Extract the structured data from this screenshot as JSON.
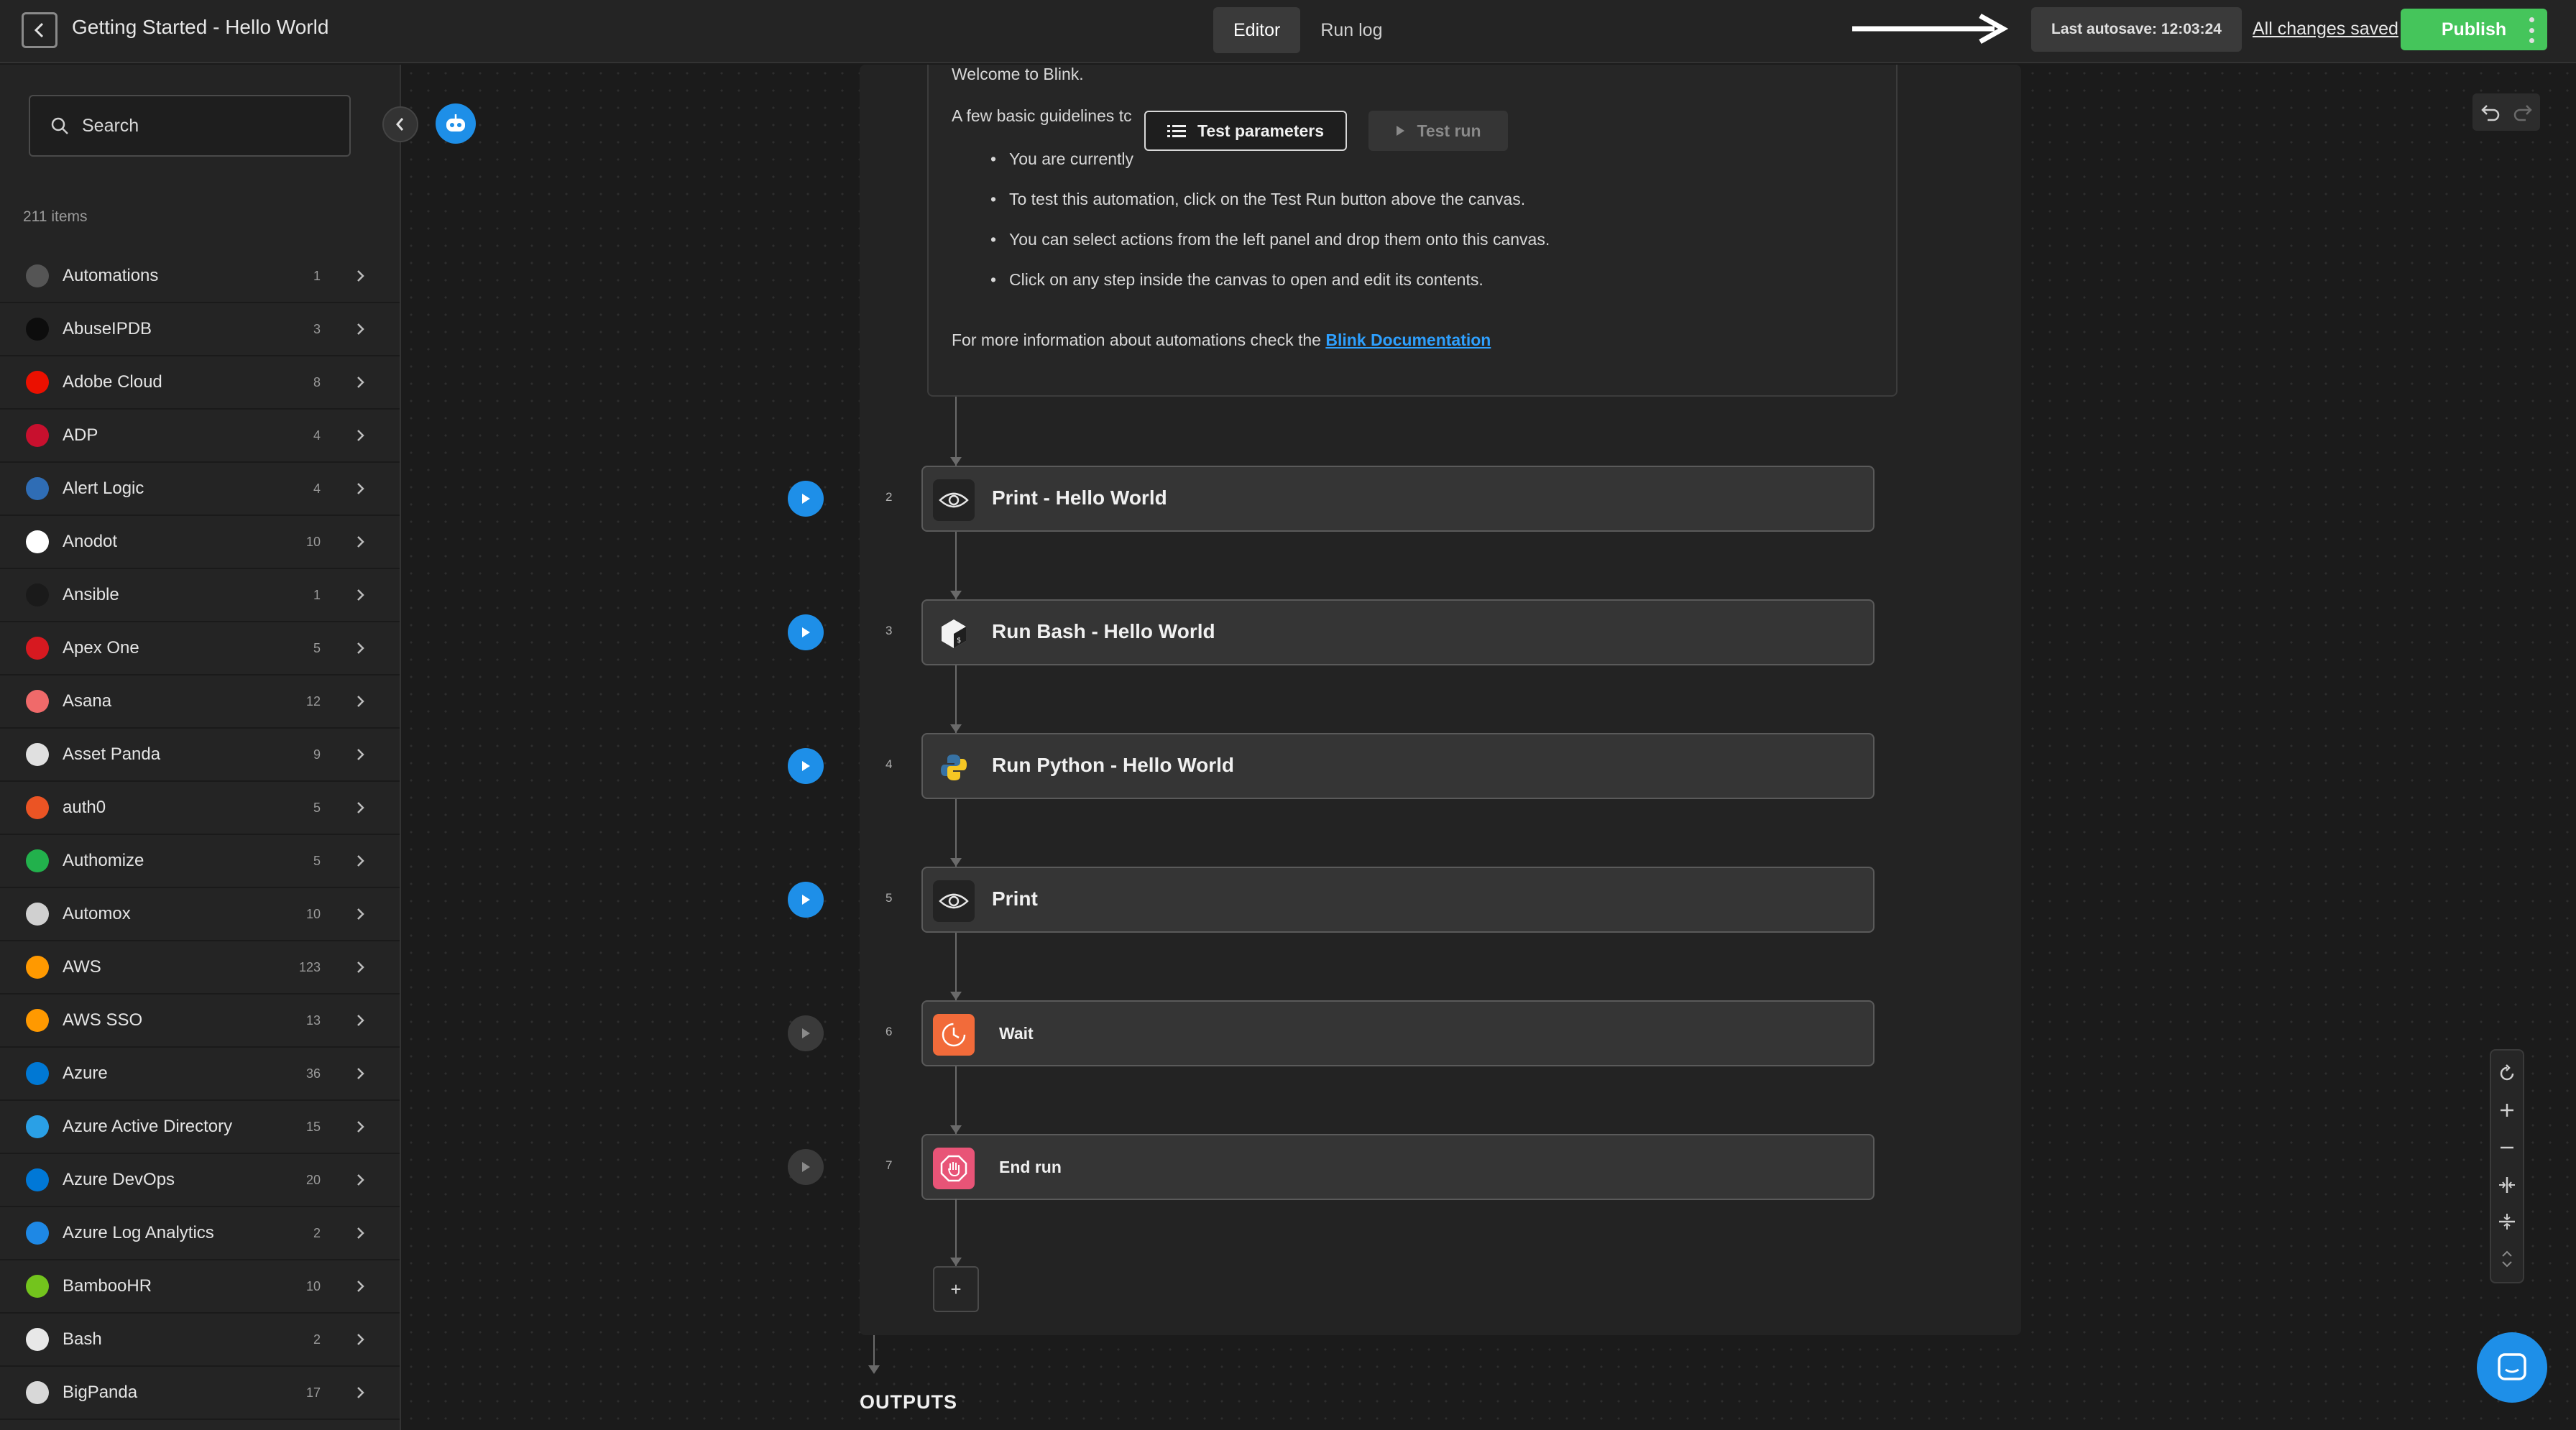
{
  "header": {
    "title": "Getting Started - Hello World",
    "tabs": [
      {
        "label": "Editor",
        "active": true
      },
      {
        "label": "Run log",
        "active": false
      }
    ],
    "autosave": "Last autosave: 12:03:24",
    "saved_status": "All changes saved",
    "publish_label": "Publish"
  },
  "sidebar": {
    "search_placeholder": "Search",
    "items_count": "211 items",
    "items": [
      {
        "label": "Automations",
        "count": "1",
        "icon": "automations-icon",
        "color": "#555555"
      },
      {
        "label": "AbuseIPDB",
        "count": "3",
        "icon": "abuseipdb-icon",
        "color": "#0d0d0d"
      },
      {
        "label": "Adobe Cloud",
        "count": "8",
        "icon": "adobe-icon",
        "color": "#eb1000"
      },
      {
        "label": "ADP",
        "count": "4",
        "icon": "adp-icon",
        "color": "#c8102e"
      },
      {
        "label": "Alert Logic",
        "count": "4",
        "icon": "alert-logic-icon",
        "color": "#2f6db5"
      },
      {
        "label": "Anodot",
        "count": "10",
        "icon": "anodot-icon",
        "color": "#ffffff"
      },
      {
        "label": "Ansible",
        "count": "1",
        "icon": "ansible-icon",
        "color": "#1a1a1a"
      },
      {
        "label": "Apex One",
        "count": "5",
        "icon": "apex-one-icon",
        "color": "#d71920"
      },
      {
        "label": "Asana",
        "count": "12",
        "icon": "asana-icon",
        "color": "#f06a6a"
      },
      {
        "label": "Asset Panda",
        "count": "9",
        "icon": "asset-panda-icon",
        "color": "#e0e0e0"
      },
      {
        "label": "auth0",
        "count": "5",
        "icon": "auth0-icon",
        "color": "#eb5424"
      },
      {
        "label": "Authomize",
        "count": "5",
        "icon": "authomize-icon",
        "color": "#22b14c"
      },
      {
        "label": "Automox",
        "count": "10",
        "icon": "automox-icon",
        "color": "#d0d0d0"
      },
      {
        "label": "AWS",
        "count": "123",
        "icon": "aws-icon",
        "color": "#ff9900"
      },
      {
        "label": "AWS SSO",
        "count": "13",
        "icon": "aws-sso-icon",
        "color": "#ff9900"
      },
      {
        "label": "Azure",
        "count": "36",
        "icon": "azure-icon",
        "color": "#0078d4"
      },
      {
        "label": "Azure Active Directory",
        "count": "15",
        "icon": "azure-ad-icon",
        "color": "#2aa0e6"
      },
      {
        "label": "Azure DevOps",
        "count": "20",
        "icon": "azure-devops-icon",
        "color": "#0078d7"
      },
      {
        "label": "Azure Log Analytics",
        "count": "2",
        "icon": "azure-log-analytics-icon",
        "color": "#1e88e5"
      },
      {
        "label": "BambooHR",
        "count": "10",
        "icon": "bamboohr-icon",
        "color": "#73c41d"
      },
      {
        "label": "Bash",
        "count": "2",
        "icon": "bash-icon",
        "color": "#e8e8e8"
      },
      {
        "label": "BigPanda",
        "count": "17",
        "icon": "bigpanda-icon",
        "color": "#d8d8d8"
      }
    ]
  },
  "welcome": {
    "line1": "Welcome to Blink.",
    "line2": "A few basic guidelines tc",
    "bullet1": "You are currently",
    "bullet2": "To test this automation, click on the Test Run button above the canvas.",
    "bullet3": "You can select actions from the left panel and drop them onto this canvas.",
    "bullet4": "Click on any step inside the canvas to open and edit its contents.",
    "more_info": "For more information about automations check the ",
    "doc_link": "Blink Documentation"
  },
  "toolbar": {
    "test_parameters": "Test parameters",
    "test_run": "Test run"
  },
  "steps": [
    {
      "num": "2",
      "title": "Print - Hello World",
      "icon": "eye-icon",
      "runnable": true
    },
    {
      "num": "3",
      "title": "Run Bash - Hello World",
      "icon": "bash-icon",
      "runnable": true
    },
    {
      "num": "4",
      "title": "Run Python - Hello World",
      "icon": "python-icon",
      "runnable": true
    },
    {
      "num": "5",
      "title": "Print",
      "icon": "eye-icon",
      "runnable": true
    },
    {
      "num": "6",
      "title": "Wait",
      "icon": "wait-icon",
      "runnable": false
    },
    {
      "num": "7",
      "title": "End run",
      "icon": "end-run-icon",
      "runnable": false
    }
  ],
  "add_step": "+",
  "outputs_label": "OUTPUTS",
  "colors": {
    "accent": "#1e8fe8",
    "publish": "#45c55b",
    "wait": "#f26b3a",
    "end_run": "#e85477"
  }
}
